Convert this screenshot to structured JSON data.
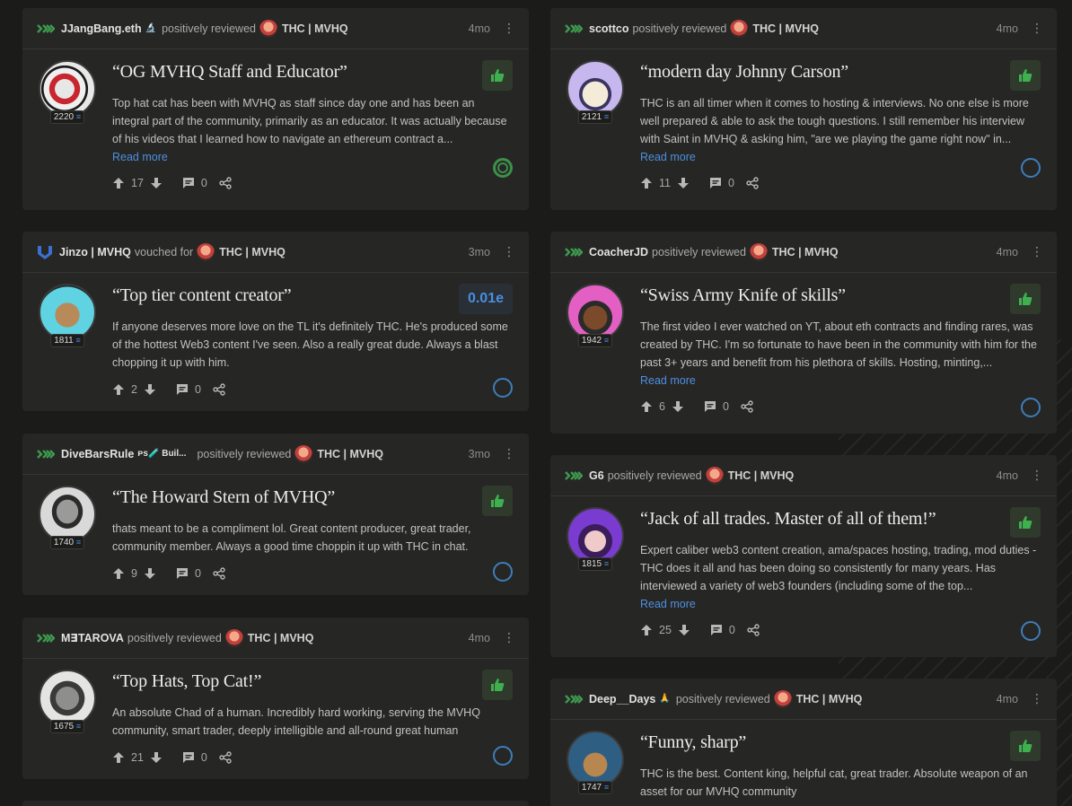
{
  "left": [
    {
      "author": "JJangBang.eth",
      "author_suffix": "🔬",
      "action": "positively reviewed",
      "subject": "THC | MVHQ",
      "age": "4mo",
      "kind": "review",
      "score": "2220",
      "title": "“OG MVHQ Staff and Educator”",
      "text": "Top hat cat has been with MVHQ as staff since day one and has been an integral part of the community, primarily as an educator. It was actually because of his videos that I learned how to navigate an ethereum contract a...",
      "read_more": "Read more",
      "up": "17",
      "comments": "0",
      "ring": "green"
    },
    {
      "author": "Jinzo | MVHQ",
      "author_suffix": "",
      "action": "vouched for",
      "subject": "THC | MVHQ",
      "age": "3mo",
      "kind": "vouch",
      "score": "1811",
      "title": "“Top tier content creator”",
      "text": "If anyone deserves more love on the TL it's definitely THC. He's produced some of the hottest Web3 content I've seen. Also a really great dude. Always a blast chopping it up with him.",
      "read_more": "",
      "up": "2",
      "comments": "0",
      "eth_amount": "0.01e",
      "ring": "blue"
    },
    {
      "author": "DiveBarsRule",
      "author_suffix": "ᴘs🧪 Buil...",
      "action": "positively reviewed",
      "subject": "THC | MVHQ",
      "age": "3mo",
      "kind": "review",
      "score": "1740",
      "title": "“The Howard Stern of MVHQ”",
      "text": "thats meant to be a compliment lol. Great content producer, great trader, community member. Always a good time choppin it up with THC in chat.",
      "read_more": "",
      "up": "9",
      "comments": "0",
      "ring": "blue"
    },
    {
      "author": "M∃TAROVA",
      "author_suffix": "",
      "action": "positively reviewed",
      "subject": "THC | MVHQ",
      "age": "4mo",
      "kind": "review",
      "score": "1675",
      "title": "“Top Hats, Top Cat!”",
      "text": "An absolute Chad of a human. Incredibly hard working, serving the MVHQ community, smart trader, deeply intelligible and all-round great human",
      "read_more": "",
      "up": "21",
      "comments": "0",
      "ring": "blue"
    }
  ],
  "right": [
    {
      "author": "scottco",
      "author_suffix": "",
      "action": "positively reviewed",
      "subject": "THC | MVHQ",
      "age": "4mo",
      "kind": "review",
      "score": "2121",
      "title": "“modern day Johnny Carson”",
      "text": "THC is an all timer when it comes to hosting & interviews. No one else is more well prepared & able to ask the tough questions. I still remember his interview with Saint in MVHQ & asking him, \"are we playing the game right now\" in...",
      "read_more": "Read more",
      "up": "11",
      "comments": "0",
      "ring": "blue"
    },
    {
      "author": "CoacherJD",
      "author_suffix": "",
      "action": "positively reviewed",
      "subject": "THC | MVHQ",
      "age": "4mo",
      "kind": "review",
      "score": "1942",
      "title": "“Swiss Army Knife of skills”",
      "text": "The first video I ever watched on YT, about eth contracts and finding rares, was created by THC. I'm so fortunate to have been in the community with him for the past 3+ years and benefit from his plethora of skills. Hosting, minting,...",
      "read_more": "Read more",
      "up": "6",
      "comments": "0",
      "ring": "blue"
    },
    {
      "author": "G6",
      "author_suffix": "",
      "action": "positively reviewed",
      "subject": "THC | MVHQ",
      "age": "4mo",
      "kind": "review",
      "score": "1815",
      "title": "“Jack of all trades. Master of all of them!”",
      "text": "Expert caliber web3 content creation, ama/spaces hosting, trading, mod duties - THC does it all and has been doing so consistently for many years. Has interviewed a variety of web3 founders (including some of the top...",
      "read_more": "Read more",
      "up": "25",
      "comments": "0",
      "ring": "blue"
    },
    {
      "author": "Deep__Days",
      "author_suffix": "🙏",
      "action": "positively reviewed",
      "subject": "THC | MVHQ",
      "age": "4mo",
      "kind": "review",
      "score": "1747",
      "title": "“Funny, sharp”",
      "text": "THC is the best. Content king, helpful cat, great trader. Absolute weapon of an asset for our MVHQ community",
      "read_more": "",
      "up": "",
      "comments": "",
      "ring": ""
    }
  ],
  "colors": {
    "green": "#3d8f4a",
    "blue": "#4f8fe0",
    "card": "#262625",
    "bg": "#1b1b1a"
  },
  "icons": [
    "positive-review-icon",
    "vouch-icon",
    "thumbs-up-icon",
    "arrow-up-icon",
    "arrow-down-icon",
    "comment-icon",
    "share-icon",
    "kebab-menu-icon",
    "ethereum-icon"
  ]
}
